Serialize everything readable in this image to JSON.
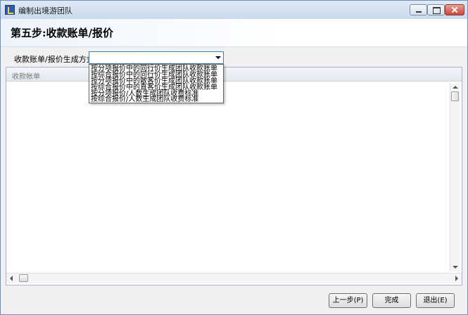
{
  "window": {
    "title": "编制出境游团队",
    "buttons": [
      "minimize",
      "maximize",
      "close"
    ],
    "icon": "app-icon"
  },
  "header": {
    "step_title": "第五步:收款账单/报价"
  },
  "method": {
    "label": "收款账单/报价生成方式:",
    "selected": "",
    "options": [
      "按分项报价中的同行价生成团队收款账单",
      "按综合报价中的同行价生成团队收款账单",
      "按分项报价中的散客价生成团队收款账单",
      "按综合报价中的直客价生成团队收款账单",
      "按分项报价/人数生成团队收费标准",
      "按综合报价/人数生成团队收费标准"
    ]
  },
  "panel": {
    "title": "收款帐单"
  },
  "footer": {
    "prev_label": "上一步(P)",
    "finish_label": "完成",
    "exit_label": "退出(E)"
  }
}
